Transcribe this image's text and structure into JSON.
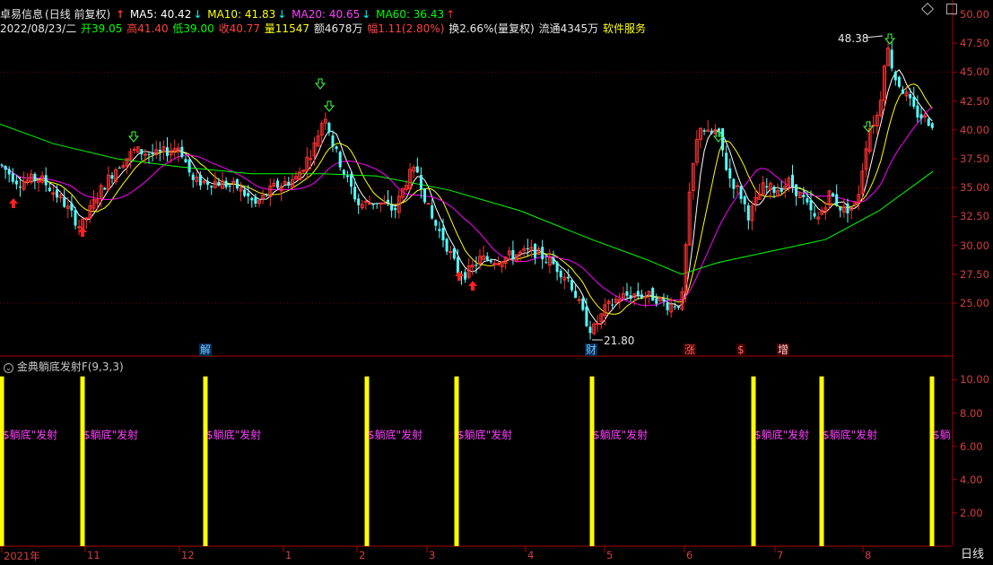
{
  "header": {
    "stock_name": "卓易信息",
    "period": "(日线 前复权)",
    "ma5_label": "MA5: 40.42",
    "ma10_label": "MA10: 41.83",
    "ma20_label": "MA20: 40.65",
    "ma60_label": "MA60: 36.43",
    "arrow_up": "↑",
    "arrow_down": "↓"
  },
  "info": {
    "date": "2022/08/23/二",
    "open": "开39.05",
    "high": "高41.40",
    "low": "低39.00",
    "close": "收40.77",
    "volume": "量11547",
    "amount": "额4678万",
    "change": "幅1.11(2.80%)",
    "turnover": "换2.66%(量复权)",
    "float": "流通4345万",
    "service": "软件服务"
  },
  "colors": {
    "up": "#ff3232",
    "down": "#54ffff",
    "ma5": "#ffffff",
    "ma10": "#ffff00",
    "ma20": "#ff00ff",
    "ma60": "#00ff00",
    "axis": "#b00000"
  },
  "price_axis": [
    "50.00",
    "47.50",
    "45.00",
    "42.50",
    "40.00",
    "37.50",
    "35.00",
    "32.50",
    "30.00",
    "27.50",
    "25.00"
  ],
  "indicator_axis": [
    "10.00",
    "8.00",
    "6.00",
    "4.00",
    "2.00"
  ],
  "annotations": {
    "high_marker": "48.38",
    "low_marker": "21.80"
  },
  "event_tags": [
    "解",
    "财",
    "涨",
    "$",
    "增"
  ],
  "indicator": {
    "name": "金典躺底发射F",
    "params": "(9,3,3)",
    "signal_text": "$躺底\"发射",
    "signal_text_cut": "$躺"
  },
  "months": [
    "2021年",
    "11",
    "12",
    "1",
    "2",
    "3",
    "4",
    "5",
    "6",
    "7",
    "8"
  ],
  "period_button": "日线",
  "chart_data": {
    "type": "candlestick",
    "ylim": [
      21.0,
      50.0
    ],
    "indicator_ylim": [
      0,
      11
    ],
    "high": 48.38,
    "low": 21.8
  }
}
